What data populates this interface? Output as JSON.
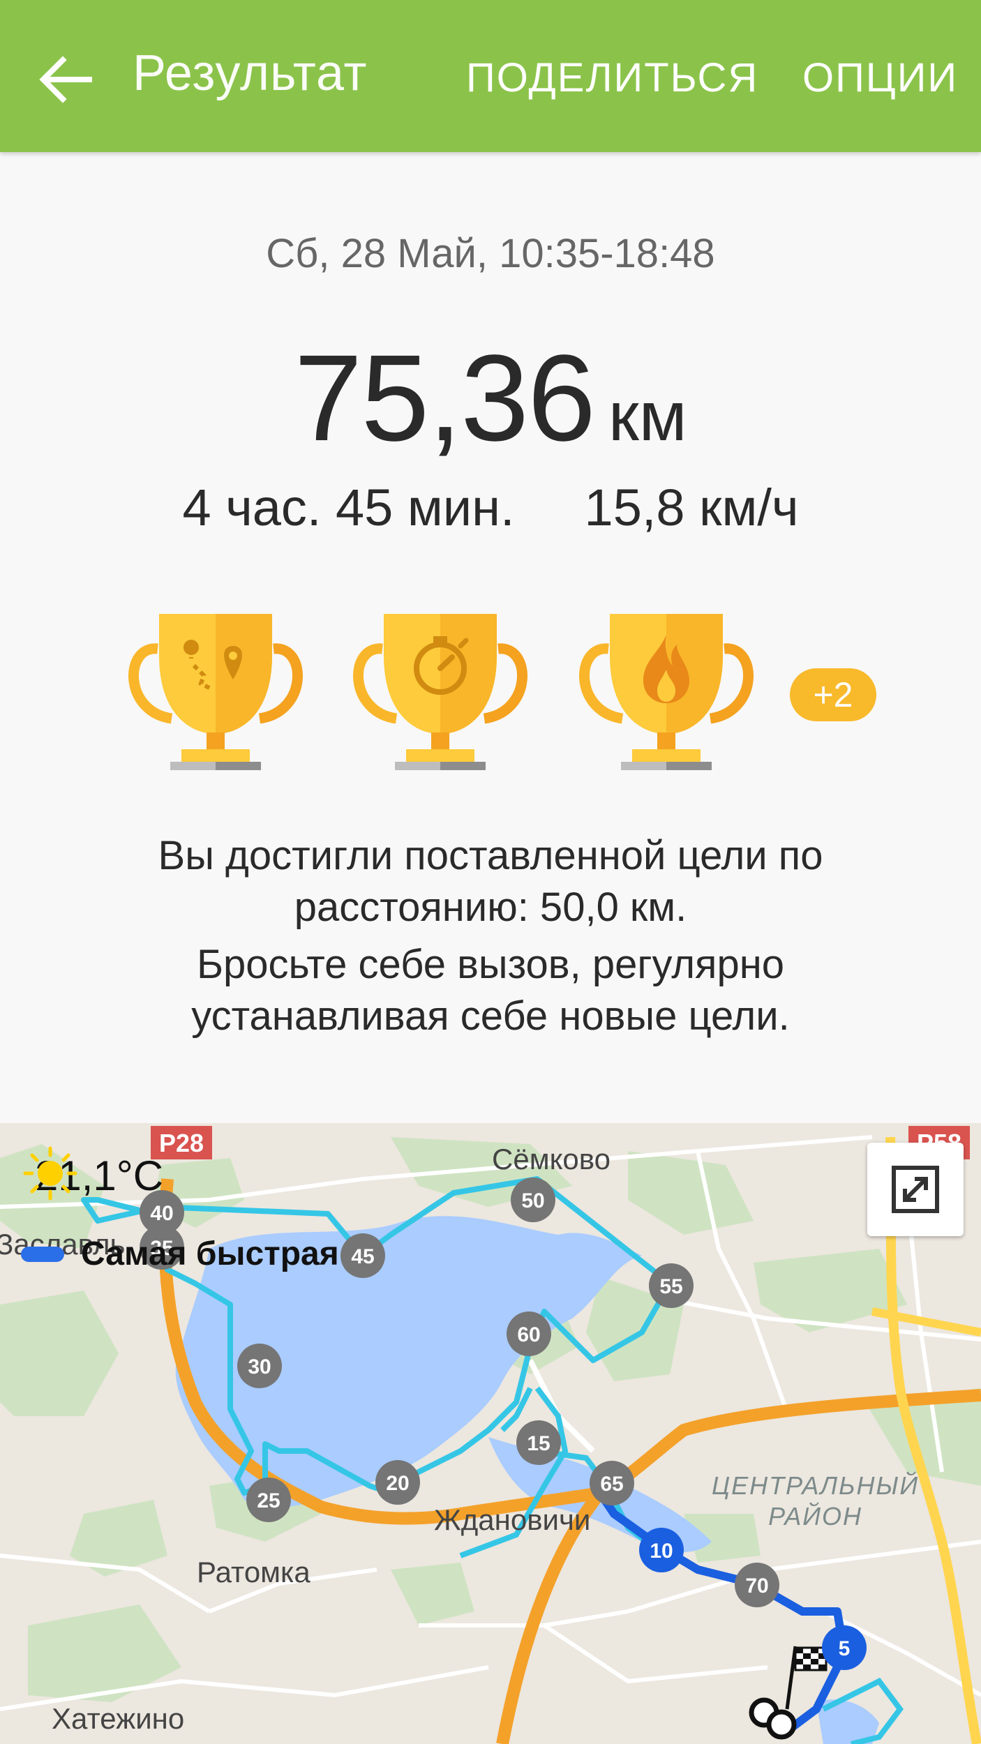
{
  "app_bar": {
    "title": "Результат",
    "share_label": "ПОДЕЛИТЬСЯ",
    "options_label": "ОПЦИИ",
    "back_icon": "arrow-left-icon"
  },
  "summary": {
    "date": "Сб, 28 Май, 10:35-18:48",
    "distance_value": "75,36",
    "distance_unit": "км",
    "duration": "4 час. 45 мин.",
    "speed": "15,8 км/ч"
  },
  "trophies": {
    "items": [
      "route-trophy-icon",
      "stopwatch-trophy-icon",
      "calories-trophy-icon"
    ],
    "more_badge": "+2"
  },
  "message": {
    "line1": "Вы достигли поставленной цели по расстоянию: 50,0 км.",
    "line2": "Бросьте себе вызов, регулярно устанавливая себе новые цели."
  },
  "map": {
    "weather_temp": "21,1°C",
    "legend_label": "Самая быстрая",
    "places": {
      "semkovo": "Сёмково",
      "zaslavl": "Заславль",
      "zhdanovichi": "Ждановичи",
      "ratomka": "Ратомка",
      "khatezhino": "Хатежино",
      "district_line1": "ЦЕНТРАЛЬНЫЙ",
      "district_line2": "РАЙОН"
    },
    "road_labels": [
      "Р28",
      "Р58"
    ],
    "km_markers": [
      "5",
      "10",
      "15",
      "20",
      "25",
      "30",
      "35",
      "40",
      "45",
      "50",
      "55",
      "60",
      "65",
      "70"
    ],
    "colors": {
      "route": "#35c6e6",
      "route_fast": "#1a5fe0",
      "marker_gray": "#757575",
      "marker_blue": "#1a5fe0",
      "water": "#aaccff",
      "accent_green": "#8bc34a",
      "trophy_gold": "#fbc02d"
    }
  }
}
